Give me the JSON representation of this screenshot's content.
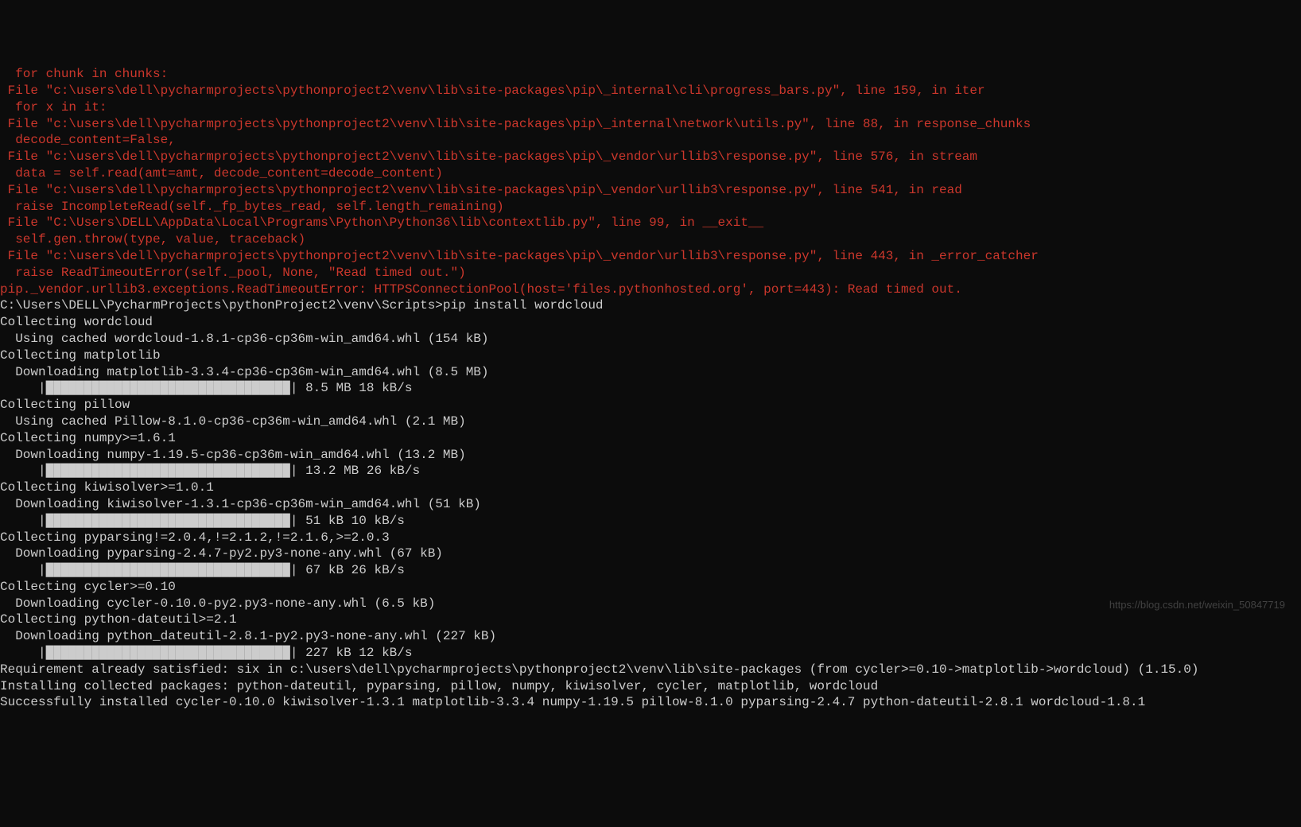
{
  "error_lines": [
    "  for chunk in chunks:",
    " File \"c:\\users\\dell\\pycharmprojects\\pythonproject2\\venv\\lib\\site-packages\\pip\\_internal\\cli\\progress_bars.py\", line 159, in iter",
    "  for x in it:",
    " File \"c:\\users\\dell\\pycharmprojects\\pythonproject2\\venv\\lib\\site-packages\\pip\\_internal\\network\\utils.py\", line 88, in response_chunks",
    "  decode_content=False,",
    " File \"c:\\users\\dell\\pycharmprojects\\pythonproject2\\venv\\lib\\site-packages\\pip\\_vendor\\urllib3\\response.py\", line 576, in stream",
    "  data = self.read(amt=amt, decode_content=decode_content)",
    " File \"c:\\users\\dell\\pycharmprojects\\pythonproject2\\venv\\lib\\site-packages\\pip\\_vendor\\urllib3\\response.py\", line 541, in read",
    "  raise IncompleteRead(self._fp_bytes_read, self.length_remaining)",
    " File \"C:\\Users\\DELL\\AppData\\Local\\Programs\\Python\\Python36\\lib\\contextlib.py\", line 99, in __exit__",
    "  self.gen.throw(type, value, traceback)",
    " File \"c:\\users\\dell\\pycharmprojects\\pythonproject2\\venv\\lib\\site-packages\\pip\\_vendor\\urllib3\\response.py\", line 443, in _error_catcher",
    "  raise ReadTimeoutError(self._pool, None, \"Read timed out.\")",
    "pip._vendor.urllib3.exceptions.ReadTimeoutError: HTTPSConnectionPool(host='files.pythonhosted.org', port=443): Read timed out."
  ],
  "blank_line": "",
  "prompt_line": "C:\\Users\\DELL\\PycharmProjects\\pythonProject2\\venv\\Scripts>pip install wordcloud",
  "output_lines": [
    "Collecting wordcloud",
    "  Using cached wordcloud-1.8.1-cp36-cp36m-win_amd64.whl (154 kB)",
    "Collecting matplotlib",
    "  Downloading matplotlib-3.3.4-cp36-cp36m-win_amd64.whl (8.5 MB)",
    "     |████████████████████████████████| 8.5 MB 18 kB/s",
    "Collecting pillow",
    "  Using cached Pillow-8.1.0-cp36-cp36m-win_amd64.whl (2.1 MB)",
    "Collecting numpy>=1.6.1",
    "  Downloading numpy-1.19.5-cp36-cp36m-win_amd64.whl (13.2 MB)",
    "     |████████████████████████████████| 13.2 MB 26 kB/s",
    "Collecting kiwisolver>=1.0.1",
    "  Downloading kiwisolver-1.3.1-cp36-cp36m-win_amd64.whl (51 kB)",
    "     |████████████████████████████████| 51 kB 10 kB/s",
    "Collecting pyparsing!=2.0.4,!=2.1.2,!=2.1.6,>=2.0.3",
    "  Downloading pyparsing-2.4.7-py2.py3-none-any.whl (67 kB)",
    "     |████████████████████████████████| 67 kB 26 kB/s",
    "Collecting cycler>=0.10",
    "  Downloading cycler-0.10.0-py2.py3-none-any.whl (6.5 kB)",
    "Collecting python-dateutil>=2.1",
    "  Downloading python_dateutil-2.8.1-py2.py3-none-any.whl (227 kB)",
    "     |████████████████████████████████| 227 kB 12 kB/s",
    "Requirement already satisfied: six in c:\\users\\dell\\pycharmprojects\\pythonproject2\\venv\\lib\\site-packages (from cycler>=0.10->matplotlib->wordcloud) (1.15.0)",
    "Installing collected packages: python-dateutil, pyparsing, pillow, numpy, kiwisolver, cycler, matplotlib, wordcloud",
    "Successfully installed cycler-0.10.0 kiwisolver-1.3.1 matplotlib-3.3.4 numpy-1.19.5 pillow-8.1.0 pyparsing-2.4.7 python-dateutil-2.8.1 wordcloud-1.8.1"
  ],
  "watermark": "https://blog.csdn.net/weixin_50847719"
}
